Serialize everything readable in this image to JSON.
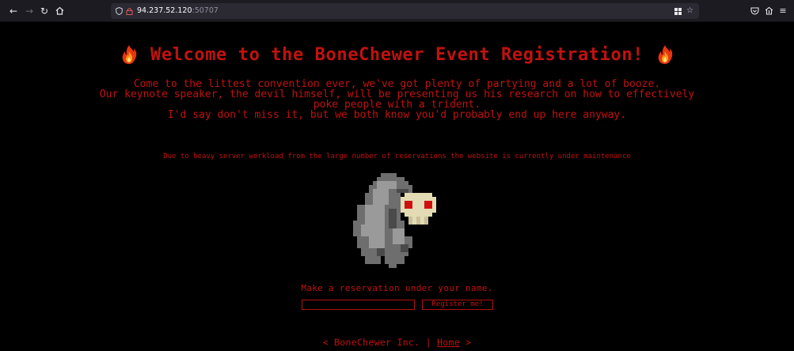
{
  "browser": {
    "url_host": "94.237.52.120",
    "url_port": ":50707",
    "icons": [
      "back-icon",
      "forward-icon",
      "reload-icon",
      "home-icon",
      "shield-icon",
      "lock-icon",
      "extensions-icon",
      "bookmark-star-icon",
      "pocket-icon",
      "share-icon",
      "menu-icon"
    ]
  },
  "header": {
    "title": "Welcome to the BoneChewer Event Registration!"
  },
  "intro": {
    "line1": "Come to the littest convention ever, we've got plenty of partying and a lot of booze.",
    "line2": "Our keynote speaker, the devil himself, will be presenting us his research on how to effectively",
    "line3": "poke people with a trident.",
    "line4": "I'd say don't miss it, but we both know you'd probably end up here anyway."
  },
  "notice": "Due to heavy server workload from the large number of reservations the website is currently under maintenance",
  "form": {
    "prompt": "Make a reservation under your name.",
    "name_value": "",
    "button_label": "Register me!"
  },
  "footer": {
    "prefix": "< BoneChewer Inc. | ",
    "home_link": "Home",
    "suffix": " >"
  },
  "colors": {
    "text": "#c0120f",
    "background": "#000000",
    "chrome": "#1c1b22"
  }
}
